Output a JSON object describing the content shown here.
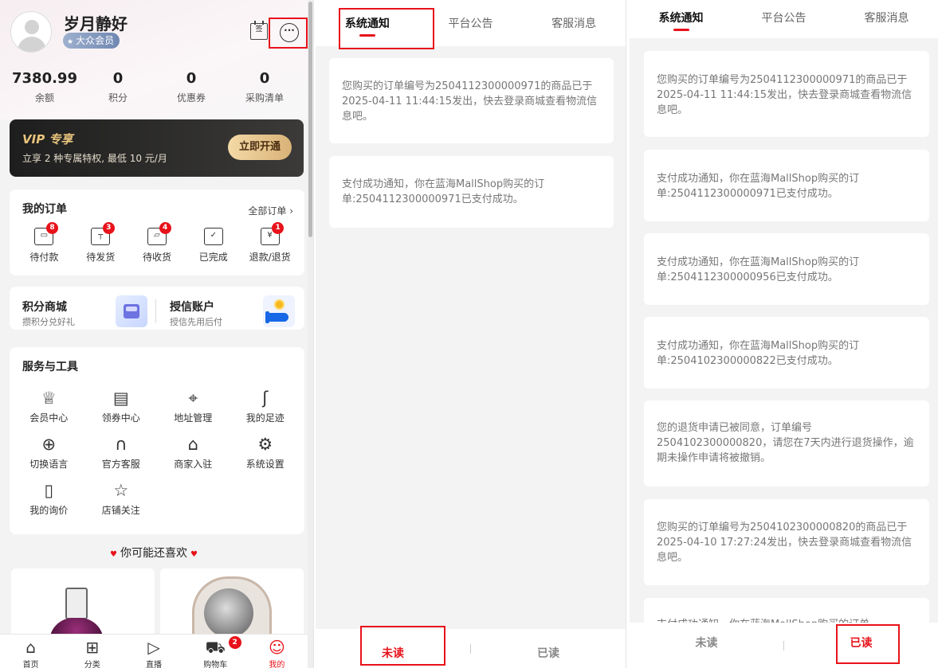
{
  "profile": {
    "username": "岁月静好",
    "member_level": "大众会员",
    "checkin_icon_text": "签",
    "icons": {
      "avatar": "default-avatar-icon",
      "checkin": "calendar-checkin-icon",
      "messages": "chat-bubble-icon"
    }
  },
  "stats": [
    {
      "value": "7380.99",
      "label": "余额"
    },
    {
      "value": "0",
      "label": "积分"
    },
    {
      "value": "0",
      "label": "优惠券"
    },
    {
      "value": "0",
      "label": "采购清单"
    }
  ],
  "vip": {
    "title": "VIP 专享",
    "subtitle": "立享 2 种专属特权, 最低 10 元/月",
    "button": "立即开通"
  },
  "orders": {
    "title": "我的订单",
    "all_link": "全部订单",
    "items": [
      {
        "label": "待付款",
        "badge": "8",
        "icon": "wallet-icon"
      },
      {
        "label": "待发货",
        "badge": "3",
        "icon": "package-icon"
      },
      {
        "label": "待收货",
        "badge": "4",
        "icon": "truck-icon"
      },
      {
        "label": "已完成",
        "badge": "",
        "icon": "clipboard-check-icon"
      },
      {
        "label": "退款/退货",
        "badge": "1",
        "icon": "refund-icon"
      }
    ]
  },
  "promo": {
    "points_mall": {
      "title": "积分商城",
      "subtitle": "攒积分兑好礼"
    },
    "credit_account": {
      "title": "授信账户",
      "subtitle": "授信先用后付"
    }
  },
  "tools": {
    "title": "服务与工具",
    "items": [
      {
        "label": "会员中心",
        "icon": "crown-icon"
      },
      {
        "label": "领券中心",
        "icon": "coupon-icon"
      },
      {
        "label": "地址管理",
        "icon": "location-pin-icon"
      },
      {
        "label": "我的足迹",
        "icon": "footprint-icon"
      },
      {
        "label": "切换语言",
        "icon": "globe-icon"
      },
      {
        "label": "官方客服",
        "icon": "headset-icon"
      },
      {
        "label": "商家入驻",
        "icon": "storefront-icon"
      },
      {
        "label": "系统设置",
        "icon": "gear-icon"
      },
      {
        "label": "我的询价",
        "icon": "price-inquiry-icon"
      },
      {
        "label": "店铺关注",
        "icon": "star-icon"
      }
    ]
  },
  "recommend_title": "你可能还喜欢",
  "nav": {
    "items": [
      {
        "label": "首页",
        "icon": "home-icon"
      },
      {
        "label": "分类",
        "icon": "grid-icon"
      },
      {
        "label": "直播",
        "icon": "play-icon"
      },
      {
        "label": "购物车",
        "icon": "cart-icon",
        "badge": "2"
      },
      {
        "label": "我的",
        "icon": "profile-smile-icon"
      }
    ]
  },
  "notifications": {
    "tabs": [
      "系统通知",
      "平台公告",
      "客服消息"
    ],
    "unread_label": "未读",
    "read_label": "已读",
    "unread_messages": [
      "您购买的订单编号为2504112300000971的商品已于2025-04-11 11:44:15发出，快去登录商城查看物流信息吧。",
      "支付成功通知，你在蓝海MallShop购买的订单:2504112300000971已支付成功。"
    ],
    "read_messages": [
      "您购买的订单编号为2504112300000971的商品已于2025-04-11 11:44:15发出，快去登录商城查看物流信息吧。",
      "支付成功通知，你在蓝海MallShop购买的订单:2504112300000971已支付成功。",
      "支付成功通知，你在蓝海MallShop购买的订单:2504112300000956已支付成功。",
      "支付成功通知，你在蓝海MallShop购买的订单:2504102300000822已支付成功。",
      "您的退货申请已被同意，订单编号2504102300000820，请您在7天内进行退货操作，逾期未操作申请将被撤销。",
      "您购买的订单编号为2504102300000820的商品已于2025-04-10 17:27:24发出，快去登录商城查看物流信息吧。",
      "支付成功通知，你在蓝海MallShop购买的订单"
    ]
  },
  "colors": {
    "accent": "#e8121a",
    "highlight_box": "#e8121a",
    "vip_gold": "#e8c47c"
  }
}
